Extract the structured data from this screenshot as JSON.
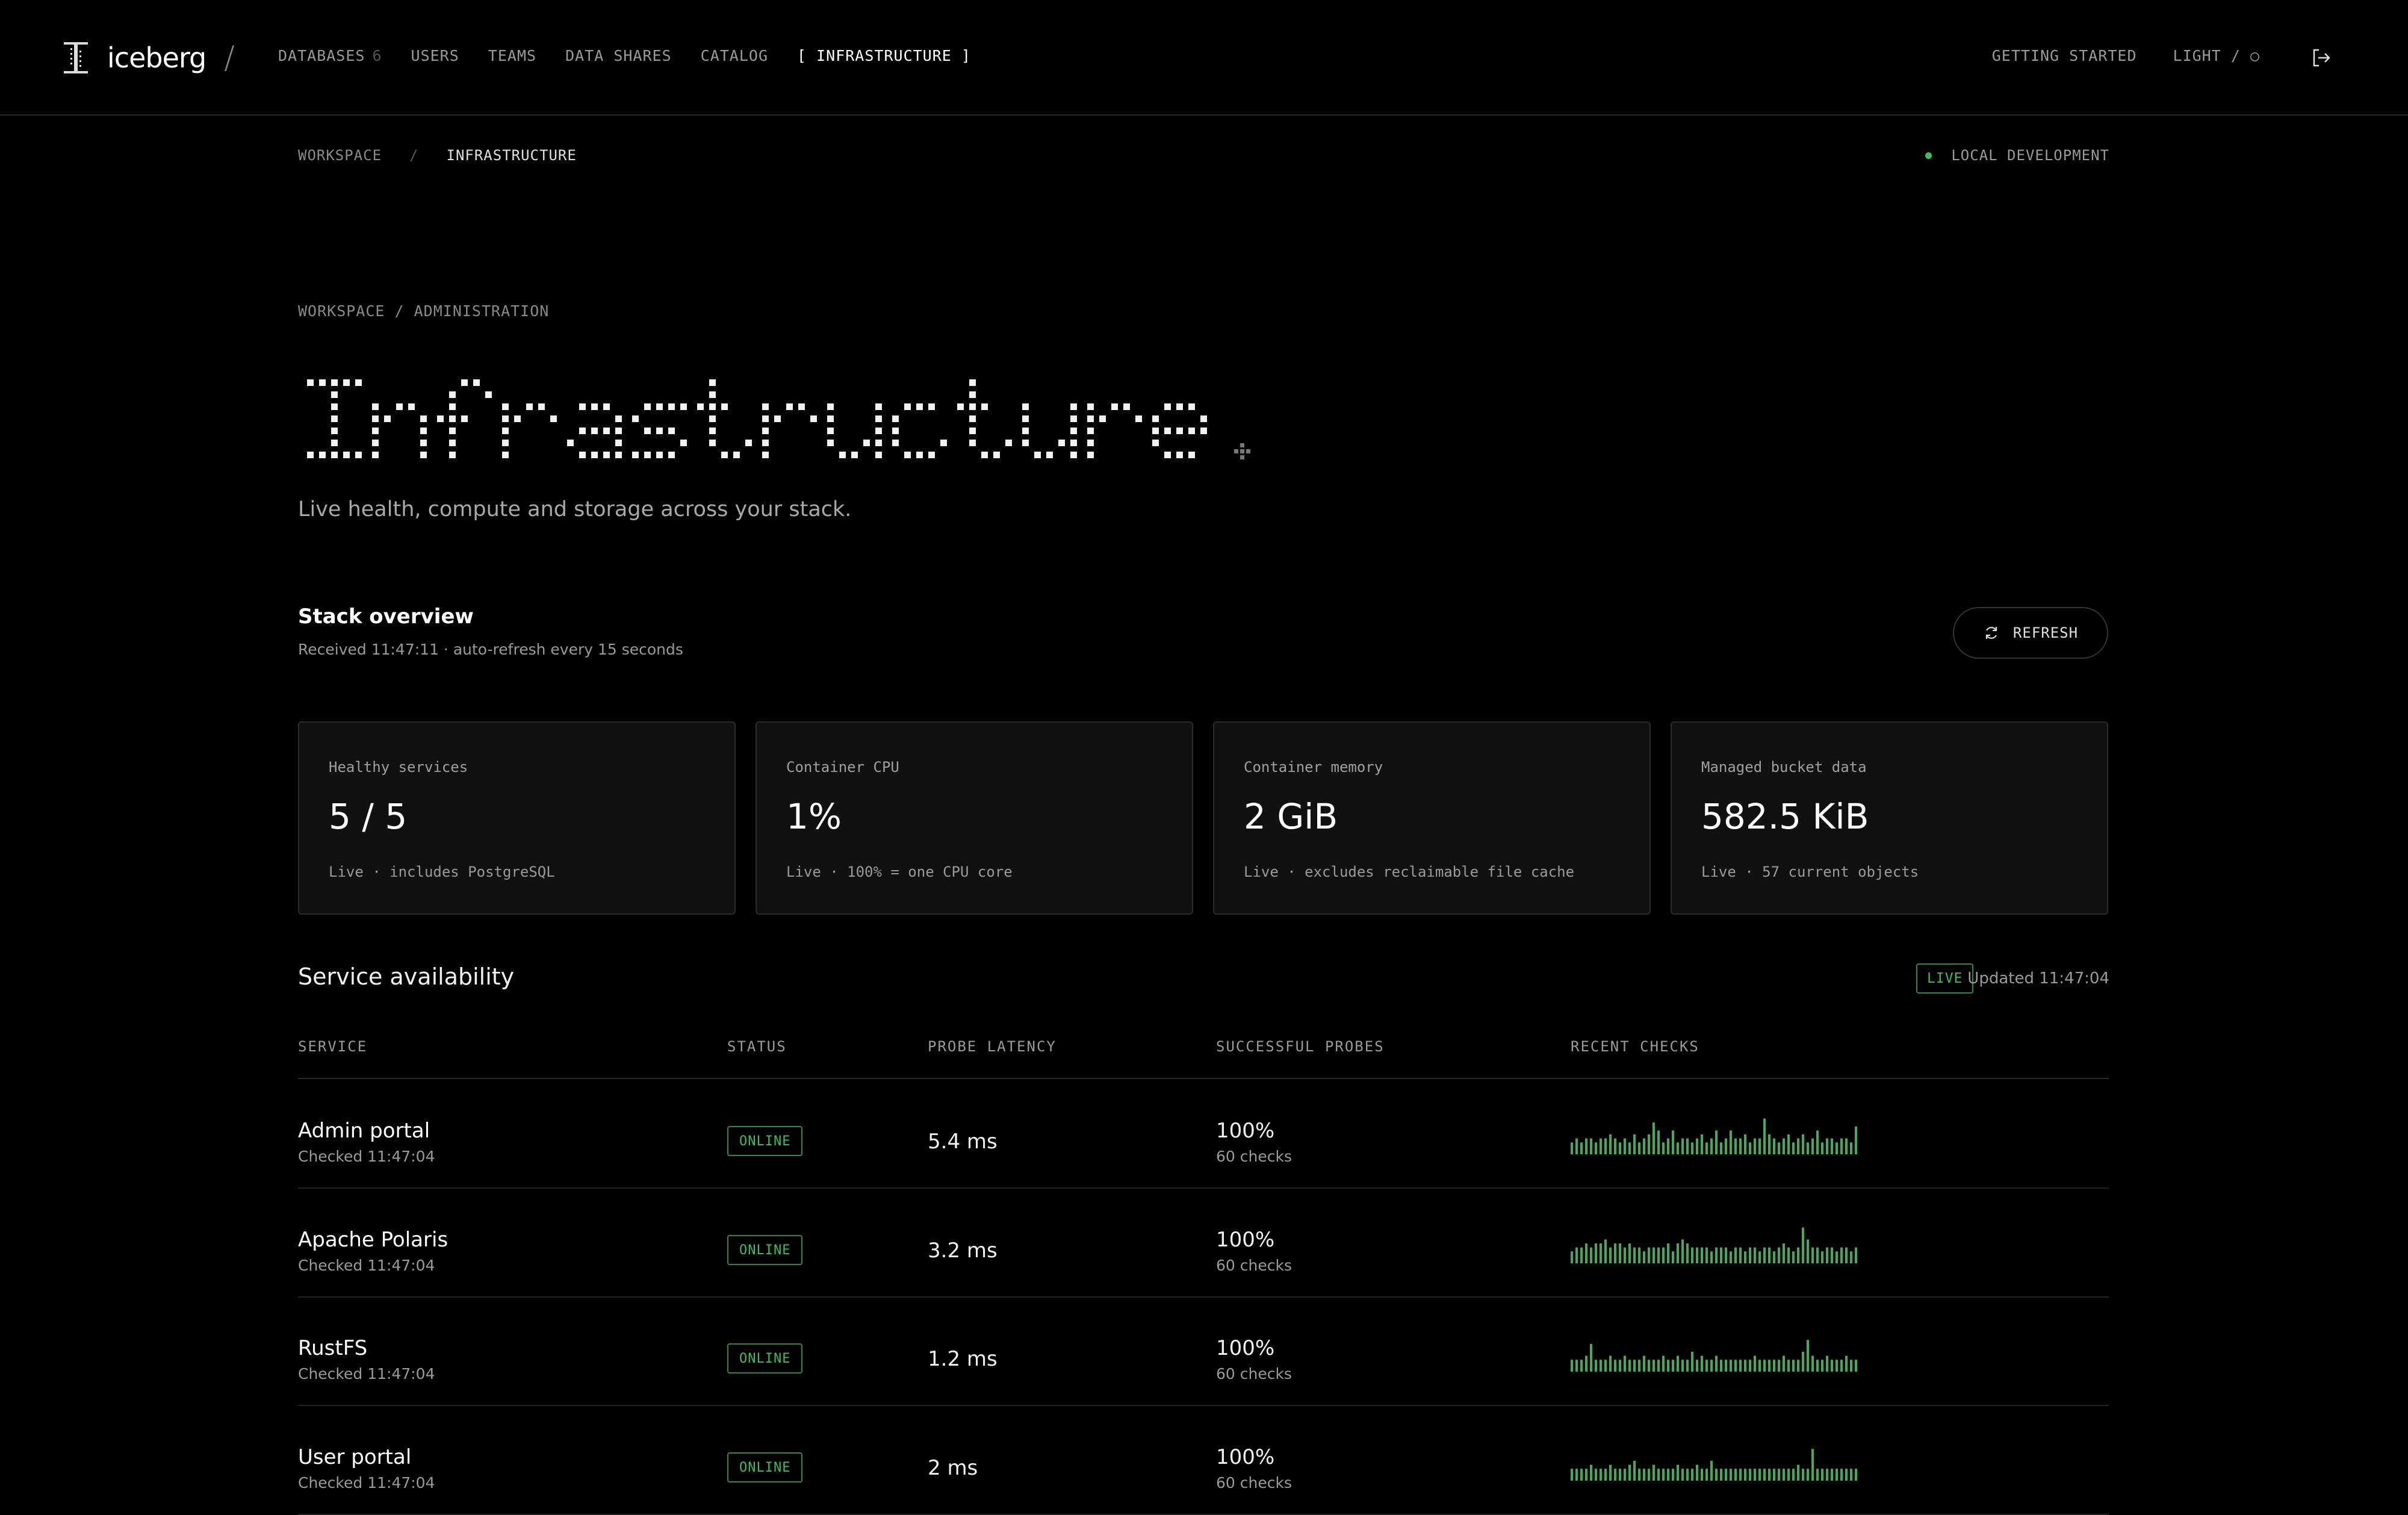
{
  "app": {
    "name": "iceberg",
    "slash": "/",
    "logo_icon": "iceberg-logo-icon"
  },
  "nav": {
    "items": [
      {
        "label": "DATABASES",
        "count": "6"
      },
      {
        "label": "USERS"
      },
      {
        "label": "TEAMS"
      },
      {
        "label": "DATA SHARES"
      },
      {
        "label": "CATALOG"
      },
      {
        "label": "[ INFRASTRUCTURE ]",
        "active": true
      }
    ],
    "getting_started": "GETTING STARTED",
    "theme_toggle": "LIGHT / ○",
    "logout_icon": "logout-icon"
  },
  "breadcrumb": {
    "root": "WORKSPACE",
    "sep": "/",
    "current": "INFRASTRUCTURE"
  },
  "environment": {
    "label": "LOCAL DEVELOPMENT",
    "dot_color": "#3bbf5b"
  },
  "page": {
    "kicker": "WORKSPACE / ADMINISTRATION",
    "title": "Infrastructure",
    "subtitle": "Live health, compute and storage across your stack."
  },
  "overview": {
    "title": "Stack overview",
    "subtitle": "Received 11:47:11 · auto-refresh every 15 seconds",
    "refresh_label": "REFRESH",
    "refresh_icon": "refresh-icon",
    "cards": [
      {
        "label": "Healthy services",
        "value": "5 / 5",
        "note": "Live · includes PostgreSQL"
      },
      {
        "label": "Container CPU",
        "value": "1%",
        "note": "Live · 100% = one CPU core"
      },
      {
        "label": "Container memory",
        "value": "2 GiB",
        "note": "Live · excludes reclaimable file cache"
      },
      {
        "label": "Managed bucket data",
        "value": "582.5 KiB",
        "note": "Live · 57 current objects"
      }
    ]
  },
  "availability": {
    "title": "Service availability",
    "live_badge": "LIVE",
    "updated": "Updated 11:47:04",
    "columns": [
      "SERVICE",
      "STATUS",
      "PROBE LATENCY",
      "SUCCESSFUL PROBES",
      "RECENT CHECKS"
    ],
    "rows": [
      {
        "name": "Admin portal",
        "checked": "Checked 11:47:04",
        "status": "ONLINE",
        "latency": "5.4 ms",
        "success": "100%",
        "checks": "60 checks",
        "spark": [
          3,
          4,
          3,
          4,
          4,
          3,
          4,
          4,
          5,
          4,
          3,
          4,
          3,
          5,
          3,
          4,
          5,
          8,
          6,
          3,
          4,
          6,
          3,
          4,
          4,
          3,
          4,
          5,
          3,
          4,
          6,
          3,
          4,
          6,
          4,
          4,
          5,
          3,
          4,
          4,
          9,
          5,
          4,
          3,
          4,
          5,
          3,
          4,
          5,
          3,
          4,
          6,
          3,
          4,
          4,
          3,
          4,
          4,
          3,
          7
        ]
      },
      {
        "name": "Apache Polaris",
        "checked": "Checked 11:47:04",
        "status": "ONLINE",
        "latency": "3.2 ms",
        "success": "100%",
        "checks": "60 checks",
        "spark": [
          3,
          4,
          4,
          5,
          4,
          5,
          5,
          6,
          4,
          5,
          5,
          4,
          5,
          4,
          4,
          3,
          4,
          4,
          4,
          4,
          5,
          3,
          5,
          6,
          5,
          4,
          4,
          4,
          4,
          3,
          4,
          4,
          4,
          3,
          4,
          4,
          3,
          4,
          4,
          3,
          4,
          4,
          3,
          4,
          5,
          4,
          3,
          4,
          9,
          6,
          4,
          4,
          3,
          4,
          4,
          3,
          4,
          4,
          3,
          4
        ]
      },
      {
        "name": "RustFS",
        "checked": "Checked 11:47:04",
        "status": "ONLINE",
        "latency": "1.2 ms",
        "success": "100%",
        "checks": "60 checks",
        "spark": [
          3,
          3,
          3,
          4,
          7,
          3,
          3,
          3,
          4,
          3,
          3,
          4,
          3,
          3,
          3,
          4,
          3,
          3,
          3,
          4,
          3,
          3,
          4,
          3,
          3,
          5,
          3,
          4,
          3,
          3,
          4,
          3,
          3,
          3,
          3,
          3,
          3,
          3,
          4,
          3,
          3,
          3,
          3,
          3,
          4,
          3,
          3,
          3,
          5,
          8,
          4,
          3,
          3,
          4,
          3,
          3,
          3,
          4,
          3,
          3
        ]
      },
      {
        "name": "User portal",
        "checked": "Checked 11:47:04",
        "status": "ONLINE",
        "latency": "2 ms",
        "success": "100%",
        "checks": "60 checks",
        "spark": [
          3,
          3,
          3,
          3,
          4,
          3,
          3,
          3,
          4,
          3,
          3,
          3,
          4,
          5,
          3,
          3,
          3,
          4,
          3,
          3,
          3,
          3,
          4,
          3,
          3,
          3,
          4,
          3,
          3,
          5,
          3,
          3,
          3,
          3,
          3,
          3,
          3,
          3,
          3,
          3,
          3,
          3,
          3,
          3,
          3,
          3,
          3,
          4,
          3,
          3,
          8,
          3,
          3,
          3,
          3,
          3,
          3,
          3,
          3,
          3
        ]
      }
    ],
    "spark_color": "#3fae5a"
  }
}
